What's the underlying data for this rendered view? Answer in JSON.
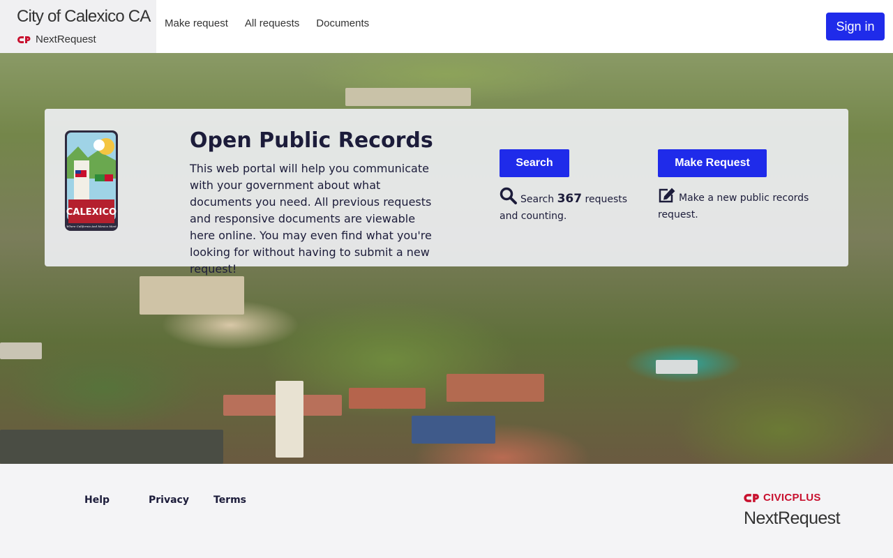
{
  "header": {
    "city_name": "City of Calexico CA",
    "product_name": "NextRequest",
    "nav": [
      {
        "label": "Make request"
      },
      {
        "label": "All requests"
      },
      {
        "label": "Documents"
      }
    ],
    "sign_in_label": "Sign in"
  },
  "hero": {
    "seal_name": "CALEXICO",
    "seal_tagline": "Where California And Mexico Meet",
    "title": "Open Public Records",
    "description": "This web portal will help you communicate with your government about what documents you need. All previous requests and responsive documents are viewable here online. You may even find what you're looking for without having to submit a new request!",
    "search_button": "Search",
    "search_prefix": "Search",
    "search_count": "367",
    "search_suffix": "requests and counting.",
    "request_button": "Make Request",
    "request_text": "Make a new public records request."
  },
  "footer": {
    "links": [
      {
        "label": "Help"
      },
      {
        "label": "Privacy"
      },
      {
        "label": "Terms"
      }
    ],
    "vendor_name": "CIVICPLUS",
    "product_name": "NextRequest"
  },
  "colors": {
    "primary_button": "#1f2bea",
    "brand_red": "#c8102e",
    "text_dark": "#1c1c3a"
  },
  "icons": [
    "nextrequest-logo-icon",
    "search-icon",
    "edit-icon",
    "civicplus-logo-icon",
    "city-seal-icon"
  ]
}
